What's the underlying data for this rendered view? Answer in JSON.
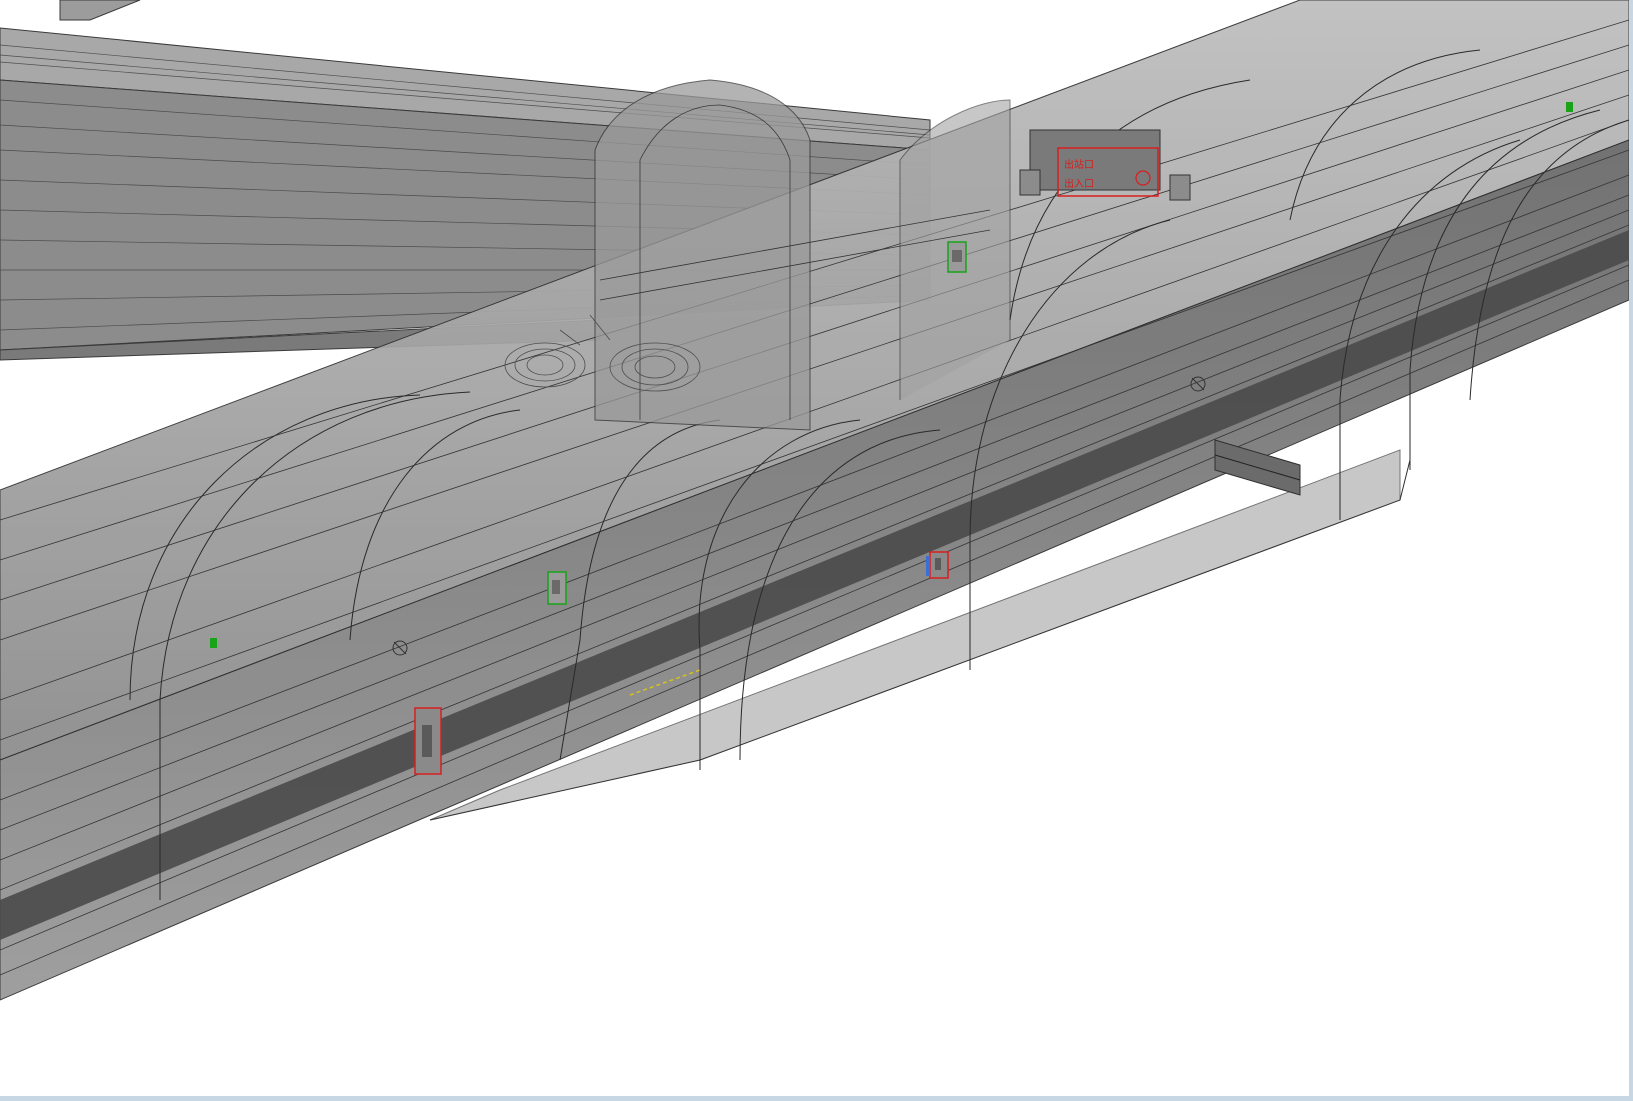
{
  "viewport": {
    "background": "#ffffff",
    "frame_color": "#c7d7e4"
  },
  "colors": {
    "shell_fill": "#8f8f8f",
    "shell_dark": "#5e5e5e",
    "shell_light": "#bdbdbd",
    "edge": "#2f2f2f",
    "highlight_red": "#d81e1e",
    "highlight_green": "#19a319",
    "highlight_blue": "#3a6fd8",
    "marker_yellow": "#d6c21a"
  },
  "sign": {
    "line1": "出站口",
    "line2": "出入口"
  },
  "icons": {
    "cable_reels": "cable-reel-icon",
    "exit_sign": "exit-sign-icon",
    "emergency_light": "emergency-light-icon",
    "fire_extinguisher": "fire-extinguisher-cabinet-icon"
  }
}
